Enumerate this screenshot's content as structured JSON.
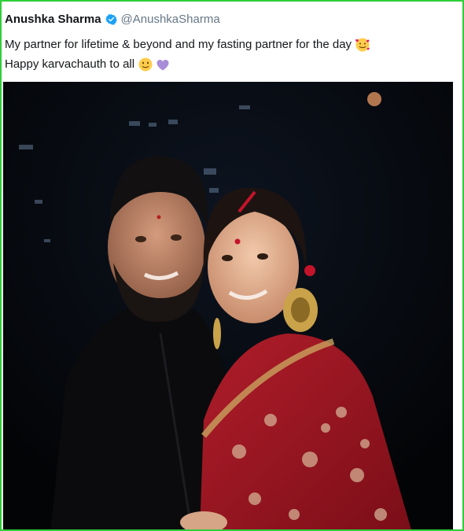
{
  "tweet": {
    "display_name": "Anushka Sharma",
    "handle": "@AnushkaSharma",
    "verified": true,
    "text_line_1": "My partner for lifetime & beyond  and my fasting partner for the day",
    "text_line_2": "Happy karvachauth to all",
    "emojis": [
      "smiling-face-with-hearts",
      "slightly-smiling-face",
      "purple-heart"
    ]
  },
  "photo": {
    "subject": "couple-portrait"
  },
  "colors": {
    "frame_border": "#2fcf3a",
    "verified_blue": "#1da1f2",
    "handle_gray": "#657786",
    "text": "#14171a"
  }
}
